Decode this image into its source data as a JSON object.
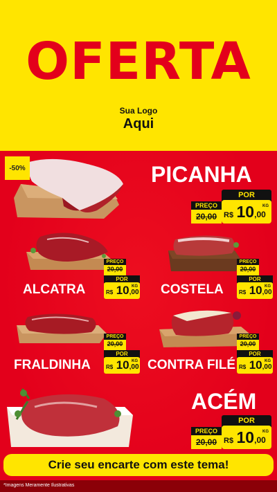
{
  "header": {
    "title": "OFERTA",
    "logo_line1": "Sua Logo",
    "logo_line2": "Aqui"
  },
  "discount_badge": "-50%",
  "price_labels": {
    "preco": "PREÇO",
    "por": "POR",
    "currency": "R$",
    "unit": "KG"
  },
  "products": [
    {
      "name": "PICANHA",
      "old_price": "20,00",
      "price_int": "10",
      "price_cents": ",00"
    },
    {
      "name": "ALCATRA",
      "old_price": "20,00",
      "price_int": "10",
      "price_cents": ",00"
    },
    {
      "name": "COSTELA",
      "old_price": "20,00",
      "price_int": "10",
      "price_cents": ",00"
    },
    {
      "name": "FRALDINHA",
      "old_price": "20,00",
      "price_int": "10",
      "price_cents": ",00"
    },
    {
      "name": "CONTRA FILÉ",
      "old_price": "20,00",
      "price_int": "10",
      "price_cents": ",00"
    },
    {
      "name": "ACÉM",
      "old_price": "20,00",
      "price_int": "10",
      "price_cents": ",00"
    }
  ],
  "cta": "Crie seu encarte com este tema!",
  "footnote": "*Imagens Meramente Ilustrativas",
  "colors": {
    "yellow": "#ffe500",
    "red": "#e3001b",
    "dark": "#111111"
  }
}
